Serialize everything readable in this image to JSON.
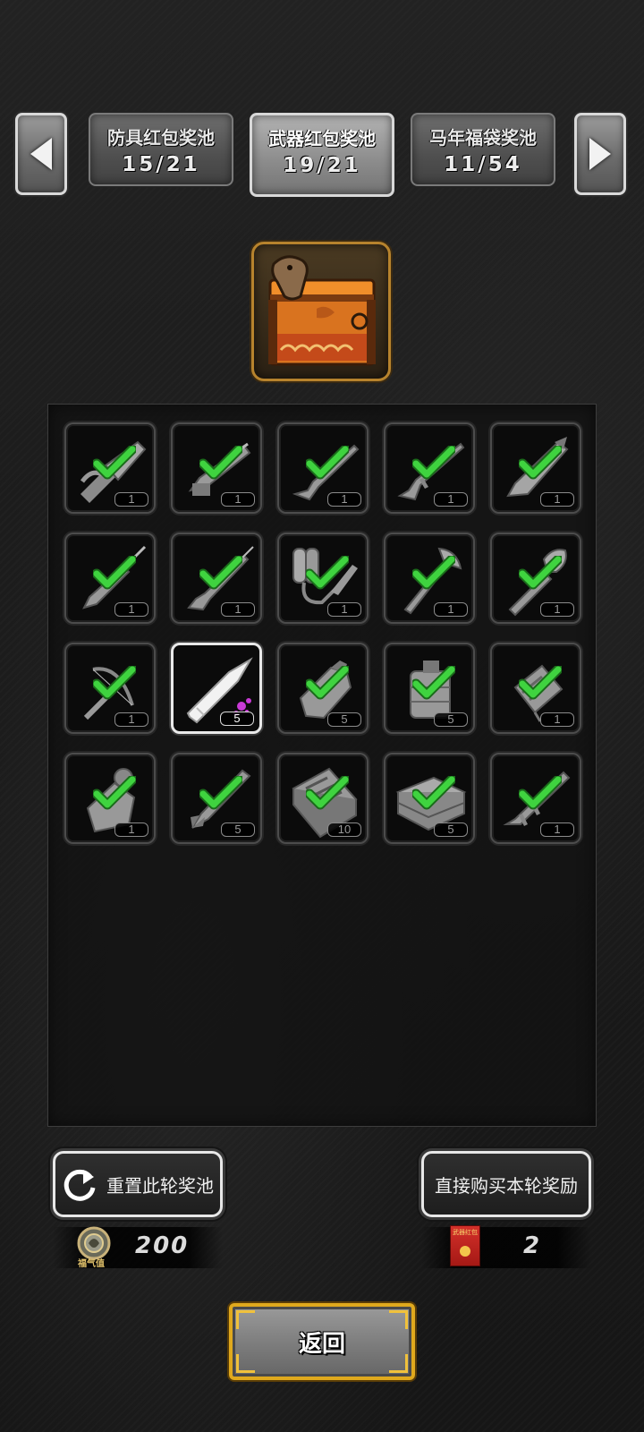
{
  "tabs": [
    {
      "name": "防具红包奖池",
      "count": "15/21",
      "active": false
    },
    {
      "name": "武器红包奖池",
      "count": "19/21",
      "active": true
    },
    {
      "name": "马年福袋奖池",
      "count": "11/54",
      "active": false
    }
  ],
  "nav": {
    "prev_icon": "arrow-left-icon",
    "next_icon": "arrow-right-icon"
  },
  "pool_icon": "horse-treasure-chest-icon",
  "rewards": [
    {
      "icon": "chainsaw-icon",
      "qty": "1",
      "claimed": true
    },
    {
      "icon": "minigun-icon",
      "qty": "1",
      "claimed": true
    },
    {
      "icon": "shotgun-icon",
      "qty": "1",
      "claimed": true
    },
    {
      "icon": "assault-rifle-icon",
      "qty": "1",
      "claimed": true
    },
    {
      "icon": "combat-knife-icon",
      "qty": "1",
      "claimed": true
    },
    {
      "icon": "spear-icon",
      "qty": "1",
      "claimed": true
    },
    {
      "icon": "sniper-rifle-icon",
      "qty": "1",
      "claimed": true
    },
    {
      "icon": "flamethrower-icon",
      "qty": "1",
      "claimed": true
    },
    {
      "icon": "axe-icon",
      "qty": "1",
      "claimed": true
    },
    {
      "icon": "shovel-icon",
      "qty": "1",
      "claimed": true
    },
    {
      "icon": "crossbow-icon",
      "qty": "1",
      "claimed": true
    },
    {
      "icon": "purple-bullet-icon",
      "qty": "5",
      "claimed": false
    },
    {
      "icon": "molotov-icon",
      "qty": "5",
      "claimed": true
    },
    {
      "icon": "cluster-grenade-icon",
      "qty": "5",
      "claimed": true
    },
    {
      "icon": "explosive-pack-icon",
      "qty": "1",
      "claimed": true
    },
    {
      "icon": "frag-grenade-icon",
      "qty": "1",
      "claimed": true
    },
    {
      "icon": "rocket-icon",
      "qty": "5",
      "claimed": true
    },
    {
      "icon": "tool-kit-icon",
      "qty": "10",
      "claimed": true
    },
    {
      "icon": "toolbox-icon",
      "qty": "5",
      "claimed": true
    },
    {
      "icon": "rocket-launcher-icon",
      "qty": "1",
      "claimed": true
    }
  ],
  "actions": {
    "reset_label": "重置此轮奖池",
    "buy_label": "直接购买本轮奖励"
  },
  "resources": {
    "luck_label": "福气值",
    "luck_value": "200",
    "redpacket_label": "武器红包",
    "redpacket_value": "2"
  },
  "return_label": "返回",
  "colors": {
    "check": "#3fd33f",
    "frame_gold": "#e0a91d",
    "bullet_accent": "#c93ad6"
  }
}
